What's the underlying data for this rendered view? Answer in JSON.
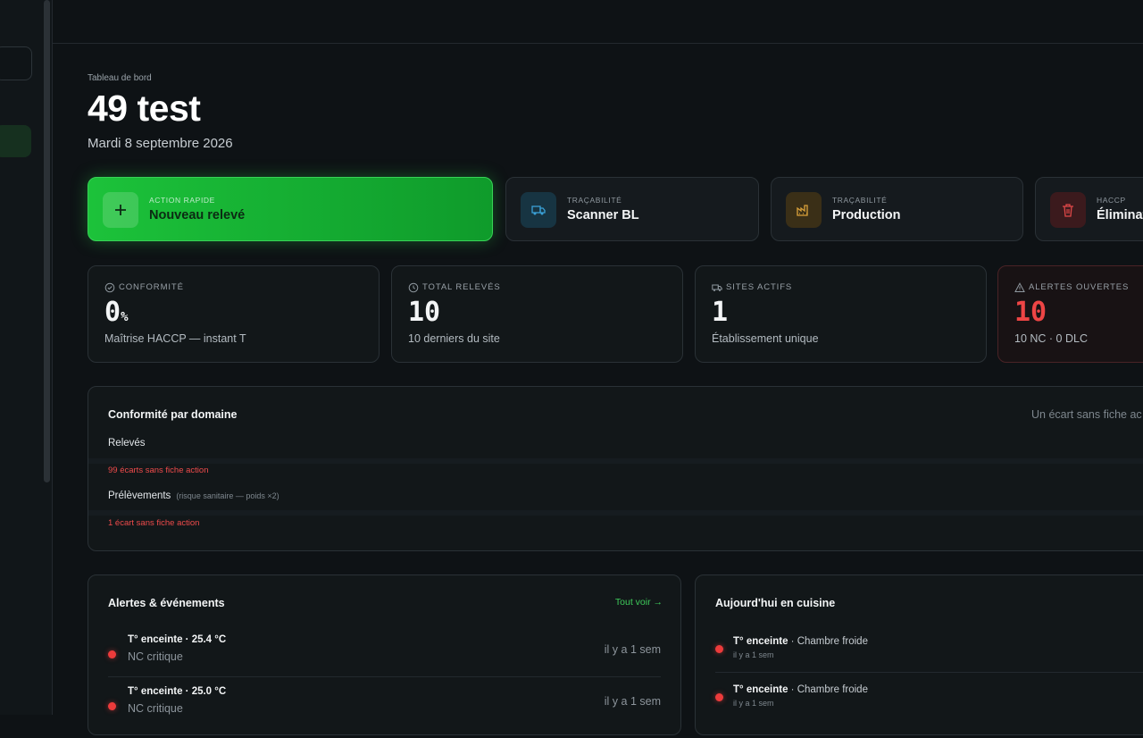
{
  "header": {
    "breadcrumb": "Tableau de bord",
    "title": "49 test",
    "date": "Mardi 8 septembre 2026"
  },
  "actions": [
    {
      "small": "ACTION RAPIDE",
      "label": "Nouveau relevé",
      "icon": "plus-icon",
      "color": "#1cc23a"
    },
    {
      "small": "TRAÇABILITÉ",
      "label": "Scanner BL",
      "icon": "truck-icon",
      "color": "#3aa0d6"
    },
    {
      "small": "TRAÇABILITÉ",
      "label": "Production",
      "icon": "factory-icon",
      "color": "#d9a13a"
    },
    {
      "small": "HACCP",
      "label": "Éliminat",
      "icon": "trash-icon",
      "color": "#e04848"
    }
  ],
  "stats": [
    {
      "label": "CONFORMITÉ",
      "value": "0",
      "unit": "%",
      "sub": "Maîtrise HACCP — instant T",
      "icon": "check-circle-icon"
    },
    {
      "label": "TOTAL RELEVÉS",
      "value": "10",
      "unit": "",
      "sub": "10 derniers du site",
      "icon": "clock-icon"
    },
    {
      "label": "SITES ACTIFS",
      "value": "1",
      "unit": "",
      "sub": "Établissement unique",
      "icon": "truck-icon"
    },
    {
      "label": "ALERTES OUVERTES",
      "value": "10",
      "unit": "",
      "sub": "10 NC · 0 DLC",
      "icon": "warning-icon"
    }
  ],
  "conformity": {
    "title": "Conformité par domaine",
    "hint": "Un écart sans fiche ac",
    "rows": [
      {
        "label": "Relevés",
        "note": "",
        "warning": "99 écarts sans fiche action"
      },
      {
        "label": "Prélèvements",
        "note": "(risque sanitaire — poids ×2)",
        "warning": "1 écart sans fiche action"
      }
    ]
  },
  "alerts": {
    "title": "Alertes & événements",
    "see_all": "Tout voir →",
    "items": [
      {
        "title": "T° enceinte · 25.4 °C",
        "status": "NC critique",
        "time": "il y a 1 sem"
      },
      {
        "title": "T° enceinte · 25.0 °C",
        "status": "NC critique",
        "time": "il y a 1 sem"
      }
    ]
  },
  "kitchen": {
    "title": "Aujourd'hui en cuisine",
    "items": [
      {
        "title": "T° enceinte",
        "place": " · Chambre froide",
        "time": "il y a 1 sem"
      },
      {
        "title": "T° enceinte",
        "place": " · Chambre froide",
        "time": "il y a 1 sem"
      }
    ]
  }
}
